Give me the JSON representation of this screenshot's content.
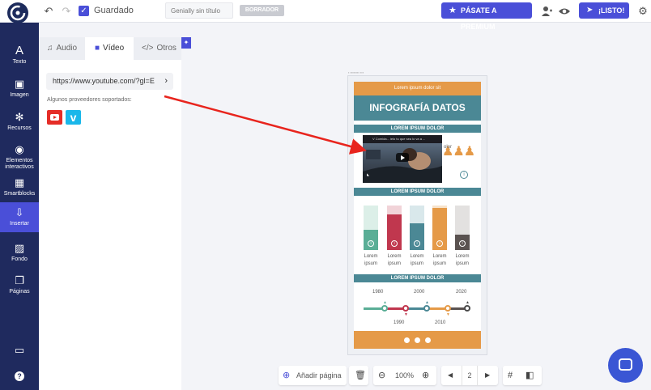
{
  "topbar": {
    "saved": "Guardado",
    "title_placeholder": "Genially sin título",
    "draft": "BORRADOR",
    "premium": "PÁSATE A PREMIUM",
    "done": "¡LISTO!"
  },
  "nav": [
    {
      "label": "Texto",
      "icon": "text-icon",
      "glyph": "A"
    },
    {
      "label": "Imagen",
      "icon": "image-icon",
      "glyph": "▣"
    },
    {
      "label": "Recursos",
      "icon": "resources-icon",
      "glyph": "✻"
    },
    {
      "label": "Elementos interactivos",
      "icon": "interactive-icon",
      "glyph": "◉"
    },
    {
      "label": "Smartblocks",
      "icon": "smartblocks-icon",
      "glyph": "▦"
    },
    {
      "label": "Insertar",
      "icon": "insert-icon",
      "glyph": "⇩"
    },
    {
      "label": "Fondo",
      "icon": "background-icon",
      "glyph": "▨"
    },
    {
      "label": "Páginas",
      "icon": "pages-icon",
      "glyph": "❐"
    }
  ],
  "panel": {
    "tabs": [
      "Audio",
      "Vídeo",
      "Otros"
    ],
    "url": "https://www.youtube.com/?gl=E",
    "providers_label": "Algunos proveedores soportados:",
    "vimeo_glyph": "v"
  },
  "infographic": {
    "top_text": "Lorem ipsum dolor sit",
    "title": "INFOGRAFÍA DATOS",
    "sections": [
      "LOREM IPSUM DOLOR",
      "LOREM IPSUM DOLOR",
      "LOREM IPSUM DOLOR"
    ],
    "video_title": "V Comida... ielo tu que sea lo va a ...",
    "video_partial_text": "olor",
    "bars": [
      {
        "value": 0.45,
        "fg": "#5aae96",
        "bg": "#dcefe8"
      },
      {
        "value": 0.8,
        "fg": "#c0374e",
        "bg": "#f1d3d8"
      },
      {
        "value": 0.6,
        "fg": "#4b8895",
        "bg": "#d9e8eb"
      },
      {
        "value": 0.95,
        "fg": "#e59a48",
        "bg": "#f7e3cc"
      },
      {
        "value": 0.35,
        "fg": "#5a5250",
        "bg": "#e3e1e0"
      }
    ],
    "bar_label": "Lorem ipsum",
    "years_top": [
      "1980",
      "2000",
      "2020"
    ],
    "years_bottom": [
      "1990",
      "2010"
    ]
  },
  "bottombar": {
    "add_page": "Añadir página",
    "zoom": "100%",
    "page": "2"
  },
  "colors": {
    "accent": "#4a4fd8",
    "nav_bg": "#1f2a5e",
    "teal": "#4b8895",
    "orange": "#e59a48",
    "arrow": "#e8241d"
  }
}
